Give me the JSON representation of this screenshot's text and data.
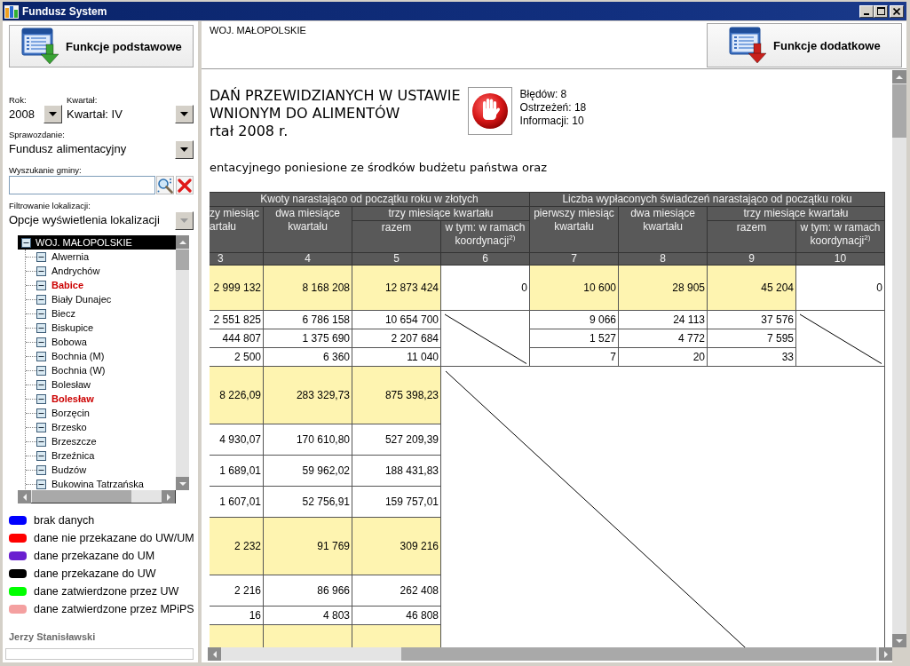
{
  "window": {
    "title": "Fundusz System"
  },
  "sidebar": {
    "button": {
      "label": "Funkcje podstawowe"
    },
    "year": {
      "label": "Rok:",
      "value": "2008",
      "disabled": false
    },
    "quarter": {
      "label": "Kwartał:",
      "value": "Kwartał: IV",
      "disabled": false
    },
    "report": {
      "label": "Sprawozdanie:",
      "value": "Fundusz alimentacyjny",
      "disabled": false
    },
    "search": {
      "label": "Wyszukanie gminy:"
    },
    "location_filter": {
      "label": "Filtrowanie lokalizacji:",
      "value": "Opcje wyświetlenia lokalizacji",
      "disabled": true
    },
    "tree": [
      {
        "label": "WOJ. MAŁOPOLSKIE",
        "selected": true,
        "expanded": true,
        "children": [
          {
            "label": "Alwernia",
            "selected": false,
            "expanded": true,
            "color": "#000000",
            "bold": false
          },
          {
            "label": "Andrychów",
            "selected": false,
            "expanded": true,
            "color": "#000000",
            "bold": false
          },
          {
            "label": "Babice",
            "selected": false,
            "expanded": true,
            "color": "#cc0000",
            "bold": true
          },
          {
            "label": "Biały Dunajec",
            "selected": false,
            "expanded": true,
            "color": "#000000",
            "bold": false
          },
          {
            "label": "Biecz",
            "selected": false,
            "expanded": true,
            "color": "#000000",
            "bold": false
          },
          {
            "label": "Biskupice",
            "selected": false,
            "expanded": true,
            "color": "#000000",
            "bold": false
          },
          {
            "label": "Bobowa",
            "selected": false,
            "expanded": true,
            "color": "#000000",
            "bold": false
          },
          {
            "label": "Bochnia (M)",
            "selected": false,
            "expanded": true,
            "color": "#000000",
            "bold": false
          },
          {
            "label": "Bochnia (W)",
            "selected": false,
            "expanded": true,
            "color": "#000000",
            "bold": false
          },
          {
            "label": "Bolesław",
            "selected": false,
            "expanded": true,
            "color": "#000000",
            "bold": false
          },
          {
            "label": "Bolesław",
            "selected": false,
            "expanded": true,
            "color": "#cc0000",
            "bold": true
          },
          {
            "label": "Borzęcin",
            "selected": false,
            "expanded": true,
            "color": "#000000",
            "bold": false
          },
          {
            "label": "Brzesko",
            "selected": false,
            "expanded": true,
            "color": "#000000",
            "bold": false
          },
          {
            "label": "Brzeszcze",
            "selected": false,
            "expanded": true,
            "color": "#000000",
            "bold": false
          },
          {
            "label": "Brzeźnica",
            "selected": false,
            "expanded": true,
            "color": "#000000",
            "bold": false
          },
          {
            "label": "Budzów",
            "selected": false,
            "expanded": true,
            "color": "#000000",
            "bold": false
          },
          {
            "label": "Bukowina Tatrzańska",
            "selected": false,
            "expanded": true,
            "color": "#000000",
            "bold": false
          }
        ]
      }
    ],
    "legend": [
      {
        "label": "brak danych",
        "color": "#0000ff"
      },
      {
        "label": "dane nie przekazane do UW/UM",
        "color": "#ff0000"
      },
      {
        "label": "dane przekazane do UM",
        "color": "#6a1fd0"
      },
      {
        "label": "dane przekazane do UW",
        "color": "#000000"
      },
      {
        "label": "dane zatwierdzone przez UW",
        "color": "#00ff00"
      },
      {
        "label": "dane zatwierdzone przez MPiPS",
        "color": "#f4a0a0"
      }
    ],
    "user": "Jerzy Stanisławski"
  },
  "content": {
    "location": "WOJ. MAŁOPOLSKIE",
    "button": {
      "label": "Funkcje dodatkowe"
    },
    "title_lines": [
      "DAŃ PRZEWIDZIANYCH W USTAWIE",
      "WNIONYM DO ALIMENTÓW",
      "rtał 2008 r."
    ],
    "messages": [
      "Błędów: 8",
      "Ostrzeżeń: 18",
      "Informacji: 10"
    ],
    "subtitle": "entacyjnego poniesione ze środków budżetu państwa oraz",
    "table": {
      "header_groups": [
        {
          "label": "Kwoty narastająco od początku roku w złotych",
          "columns": [
            {
              "label": "zy miesiąc artału"
            },
            {
              "label": "dwa miesiące kwartału"
            },
            {
              "label": "trzy miesiące kwartału",
              "children": [
                {
                  "label": "razem"
                },
                {
                  "label": "w tym: w ramach koordynacji$^{2)}$"
                }
              ]
            }
          ]
        },
        {
          "label": "Liczba wypłaconych świadczeń narastająco od początku roku",
          "columns": [
            {
              "label": "pierwszy miesiąc kwartału"
            },
            {
              "label": "dwa miesiące kwartału"
            },
            {
              "label": "trzy miesiące kwartału",
              "children": [
                {
                  "label": "razem"
                },
                {
                  "label": "w tym: w ramach koordynacji$^{2)}$"
                }
              ]
            }
          ]
        }
      ],
      "column_numbers": [
        "3",
        "4",
        "5",
        "6",
        "7",
        "8",
        "9",
        "10"
      ],
      "rows": [
        {
          "cells": [
            {
              "kind": "value",
              "text": "2 999 132",
              "highlighted": true
            },
            {
              "kind": "value",
              "text": "8 168 208",
              "highlighted": true
            },
            {
              "kind": "value",
              "text": "12 873 424",
              "highlighted": true
            },
            {
              "kind": "value",
              "text": "0",
              "highlighted": false
            },
            {
              "kind": "value",
              "text": "10 600",
              "highlighted": true
            },
            {
              "kind": "value",
              "text": "28 905",
              "highlighted": true
            },
            {
              "kind": "value",
              "text": "45 204",
              "highlighted": true
            },
            {
              "kind": "value",
              "text": "0",
              "highlighted": false
            }
          ]
        },
        {
          "cells": [
            {
              "kind": "value",
              "text": "2 551 825",
              "highlighted": false
            },
            {
              "kind": "value",
              "text": "6 786 158",
              "highlighted": false
            },
            {
              "kind": "value",
              "text": "10 654 700",
              "highlighted": false
            },
            {
              "kind": "crossed",
              "rowspan": 3
            },
            {
              "kind": "value",
              "text": "9 066",
              "highlighted": false
            },
            {
              "kind": "value",
              "text": "24 113",
              "highlighted": false
            },
            {
              "kind": "value",
              "text": "37 576",
              "highlighted": false
            },
            {
              "kind": "crossed",
              "rowspan": 3
            }
          ]
        },
        {
          "cells": [
            {
              "kind": "value",
              "text": "444 807",
              "highlighted": false
            },
            {
              "kind": "value",
              "text": "1 375 690",
              "highlighted": false
            },
            {
              "kind": "value",
              "text": "2 207 684",
              "highlighted": false
            },
            {
              "kind": "value",
              "text": "1 527",
              "highlighted": false
            },
            {
              "kind": "value",
              "text": "4 772",
              "highlighted": false
            },
            {
              "kind": "value",
              "text": "7 595",
              "highlighted": false
            }
          ]
        },
        {
          "cells": [
            {
              "kind": "value",
              "text": "2 500",
              "highlighted": false
            },
            {
              "kind": "value",
              "text": "6 360",
              "highlighted": false
            },
            {
              "kind": "value",
              "text": "11 040",
              "highlighted": false
            },
            {
              "kind": "value",
              "text": "7",
              "highlighted": false
            },
            {
              "kind": "value",
              "text": "20",
              "highlighted": false
            },
            {
              "kind": "value",
              "text": "33",
              "highlighted": false
            }
          ]
        },
        {
          "cells": [
            {
              "kind": "value",
              "text": "8 226,09",
              "highlighted": true
            },
            {
              "kind": "value",
              "text": "283 329,73",
              "highlighted": true
            },
            {
              "kind": "value",
              "text": "875 398,23",
              "highlighted": true
            },
            {
              "kind": "crossed",
              "rowspan": 8,
              "colspan": 5
            }
          ]
        },
        {
          "cells": [
            {
              "kind": "value",
              "text": "4 930,07",
              "highlighted": false
            },
            {
              "kind": "value",
              "text": "170 610,80",
              "highlighted": false
            },
            {
              "kind": "value",
              "text": "527 209,39",
              "highlighted": false
            }
          ]
        },
        {
          "cells": [
            {
              "kind": "value",
              "text": "1 689,01",
              "highlighted": false
            },
            {
              "kind": "value",
              "text": "59 962,02",
              "highlighted": false
            },
            {
              "kind": "value",
              "text": "188 431,83",
              "highlighted": false
            }
          ]
        },
        {
          "cells": [
            {
              "kind": "value",
              "text": "1 607,01",
              "highlighted": false
            },
            {
              "kind": "value",
              "text": "52 756,91",
              "highlighted": false
            },
            {
              "kind": "value",
              "text": "159 757,01",
              "highlighted": false
            }
          ]
        },
        {
          "cells": [
            {
              "kind": "value",
              "text": "2 232",
              "highlighted": true
            },
            {
              "kind": "value",
              "text": "91 769",
              "highlighted": true
            },
            {
              "kind": "value",
              "text": "309 216",
              "highlighted": true
            }
          ]
        },
        {
          "cells": [
            {
              "kind": "value",
              "text": "2 216",
              "highlighted": false
            },
            {
              "kind": "value",
              "text": "86 966",
              "highlighted": false
            },
            {
              "kind": "value",
              "text": "262 408",
              "highlighted": false
            }
          ]
        },
        {
          "cells": [
            {
              "kind": "value",
              "text": "16",
              "highlighted": false
            },
            {
              "kind": "value",
              "text": "4 803",
              "highlighted": false
            },
            {
              "kind": "value",
              "text": "46 808",
              "highlighted": false
            }
          ]
        },
        {
          "cells": [
            {
              "kind": "blank",
              "highlighted": true
            },
            {
              "kind": "blank",
              "highlighted": true
            },
            {
              "kind": "blank",
              "highlighted": true
            }
          ]
        }
      ]
    }
  }
}
